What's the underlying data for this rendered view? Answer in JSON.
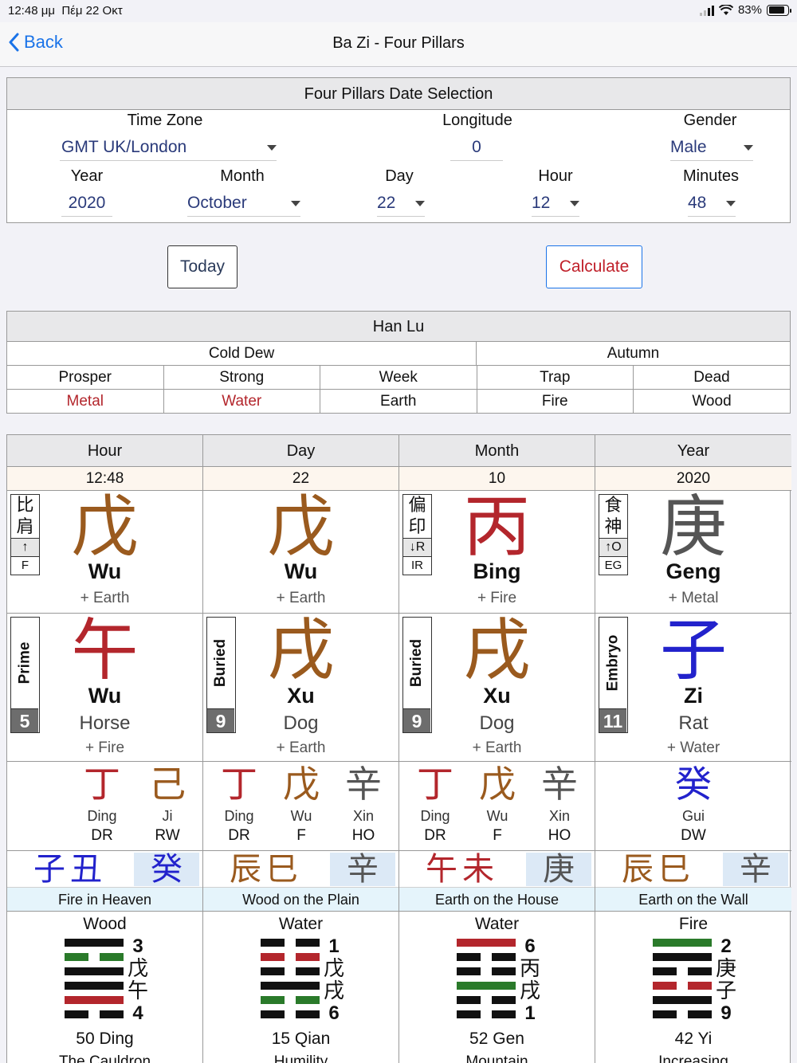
{
  "status": {
    "time": "12:48 μμ",
    "date": "Πέμ 22 Οκτ",
    "battery": "83%"
  },
  "nav": {
    "back": "Back",
    "title": "Ba Zi - Four Pillars"
  },
  "date_selection": {
    "title": "Four Pillars Date Selection",
    "timezone_label": "Time Zone",
    "timezone": "GMT UK/London",
    "longitude_label": "Longitude",
    "longitude": "0",
    "gender_label": "Gender",
    "gender": "Male",
    "year_label": "Year",
    "year": "2020",
    "month_label": "Month",
    "month": "October",
    "day_label": "Day",
    "day": "22",
    "hour_label": "Hour",
    "hour": "12",
    "minutes_label": "Minutes",
    "minutes": "48"
  },
  "buttons": {
    "today": "Today",
    "calculate": "Calculate"
  },
  "han_lu": {
    "title": "Han Lu",
    "solar_term": "Cold Dew",
    "season": "Autumn",
    "states": [
      "Prosper",
      "Strong",
      "Week",
      "Trap",
      "Dead"
    ],
    "elements": [
      "Metal",
      "Water",
      "Earth",
      "Fire",
      "Wood"
    ]
  },
  "pillars": [
    {
      "header": "Hour",
      "value": "12:48",
      "stem": {
        "glyph": "戊",
        "pinyin": "Wu",
        "element": "+ Earth",
        "color": "#9a5a1e",
        "tag": {
          "glyph1": "比",
          "glyph2": "肩",
          "sym": "↑",
          "abbr": "F"
        }
      },
      "branch": {
        "glyph": "午",
        "pinyin": "Wu",
        "animal": "Horse",
        "element": "+ Fire",
        "color": "#b3262c",
        "label": "Prime",
        "num": "5"
      },
      "hidden": [
        {
          "glyph": "丁",
          "pinyin": "Ding",
          "abbr": "DR",
          "color": "#b3262c"
        },
        {
          "glyph": "己",
          "pinyin": "Ji",
          "abbr": "RW",
          "color": "#9a5a1e"
        }
      ],
      "void": {
        "pair": "子丑",
        "pair_color": "#2222cc",
        "stem": "癸",
        "stem_color": "#2222cc",
        "nayin": "Fire in Heaven"
      },
      "hexagram": {
        "element": "Wood",
        "lines": [
          "y:#111",
          "n:#2a7a2a",
          "y:#111",
          "y:#111",
          "y:#b3262c",
          "n:#111"
        ],
        "top_num": "3",
        "c1": "戊",
        "c2": "午",
        "bottom_num": "4",
        "name": "50 Ding",
        "sub": "The Cauldron"
      }
    },
    {
      "header": "Day",
      "value": "22",
      "stem": {
        "glyph": "戊",
        "pinyin": "Wu",
        "element": "+ Earth",
        "color": "#9a5a1e",
        "tag": null
      },
      "branch": {
        "glyph": "戌",
        "pinyin": "Xu",
        "animal": "Dog",
        "element": "+ Earth",
        "color": "#9a5a1e",
        "label": "Buried",
        "num": "9"
      },
      "hidden": [
        {
          "glyph": "丁",
          "pinyin": "Ding",
          "abbr": "DR",
          "color": "#b3262c"
        },
        {
          "glyph": "戊",
          "pinyin": "Wu",
          "abbr": "F",
          "color": "#9a5a1e"
        },
        {
          "glyph": "辛",
          "pinyin": "Xin",
          "abbr": "HO",
          "color": "#555555"
        }
      ],
      "void": {
        "pair": "辰巳",
        "pair_color": "#9a5a1e",
        "stem": "辛",
        "stem_color": "#555555",
        "nayin": "Wood on the Plain"
      },
      "hexagram": {
        "element": "Water",
        "lines": [
          "n:#111",
          "n:#b3262c",
          "n:#111",
          "y:#111",
          "n:#2a7a2a",
          "n:#111"
        ],
        "top_num": "1",
        "c1": "戊",
        "c2": "戌",
        "bottom_num": "6",
        "name": "15 Qian",
        "sub": "Humility"
      }
    },
    {
      "header": "Month",
      "value": "10",
      "stem": {
        "glyph": "丙",
        "pinyin": "Bing",
        "element": "+ Fire",
        "color": "#b3262c",
        "tag": {
          "glyph1": "偏",
          "glyph2": "印",
          "sym": "↓R",
          "abbr": "IR"
        }
      },
      "branch": {
        "glyph": "戌",
        "pinyin": "Xu",
        "animal": "Dog",
        "element": "+ Earth",
        "color": "#9a5a1e",
        "label": "Buried",
        "num": "9"
      },
      "hidden": [
        {
          "glyph": "丁",
          "pinyin": "Ding",
          "abbr": "DR",
          "color": "#b3262c"
        },
        {
          "glyph": "戊",
          "pinyin": "Wu",
          "abbr": "F",
          "color": "#9a5a1e"
        },
        {
          "glyph": "辛",
          "pinyin": "Xin",
          "abbr": "HO",
          "color": "#555555"
        }
      ],
      "void": {
        "pair": "午未",
        "pair_color": "#b3262c",
        "stem": "庚",
        "stem_color": "#555555",
        "nayin": "Earth on the House"
      },
      "hexagram": {
        "element": "Water",
        "lines": [
          "y:#b3262c",
          "n:#111",
          "n:#111",
          "y:#2a7a2a",
          "n:#111",
          "n:#111"
        ],
        "top_num": "6",
        "c1": "丙",
        "c2": "戌",
        "bottom_num": "1",
        "name": "52 Gen",
        "sub": "Mountain"
      }
    },
    {
      "header": "Year",
      "value": "2020",
      "stem": {
        "glyph": "庚",
        "pinyin": "Geng",
        "element": "+ Metal",
        "color": "#555555",
        "tag": {
          "glyph1": "食",
          "glyph2": "神",
          "sym": "↑O",
          "abbr": "EG"
        }
      },
      "branch": {
        "glyph": "子",
        "pinyin": "Zi",
        "animal": "Rat",
        "element": "+ Water",
        "color": "#2222cc",
        "label": "Embryo",
        "num": "11"
      },
      "hidden": [
        {
          "glyph": "癸",
          "pinyin": "Gui",
          "abbr": "DW",
          "color": "#2222cc"
        }
      ],
      "void": {
        "pair": "辰巳",
        "pair_color": "#9a5a1e",
        "stem": "辛",
        "stem_color": "#555555",
        "nayin": "Earth on the Wall"
      },
      "hexagram": {
        "element": "Fire",
        "lines": [
          "y:#2a7a2a",
          "y:#111",
          "n:#111",
          "n:#b3262c",
          "y:#111",
          "n:#111"
        ],
        "top_num": "2",
        "c1": "庚",
        "c2": "子",
        "bottom_num": "9",
        "name": "42 Yi",
        "sub": "Increasing"
      }
    }
  ]
}
